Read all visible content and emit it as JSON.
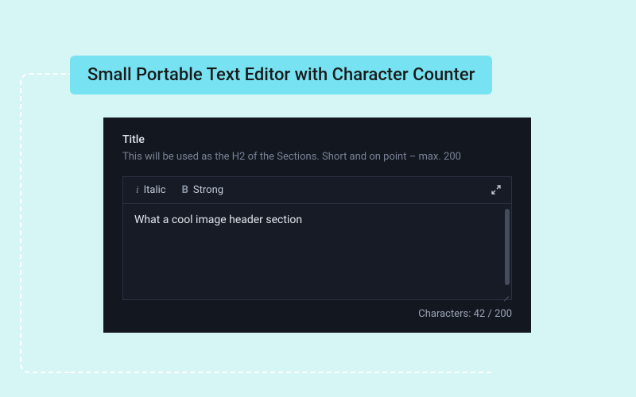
{
  "badge": {
    "text": "Small Portable Text Editor with Character Counter"
  },
  "editor": {
    "label": "Title",
    "help": "This will be used as the H2 of the Sections. Short and on point – max. 200",
    "toolbar": {
      "italic_glyph": "i",
      "italic_label": "Italic",
      "strong_glyph": "B",
      "strong_label": "Strong"
    },
    "content": "What a cool image header section",
    "counter_prefix": "Characters: ",
    "counter_current": "42",
    "counter_sep": " / ",
    "counter_max": "200"
  }
}
